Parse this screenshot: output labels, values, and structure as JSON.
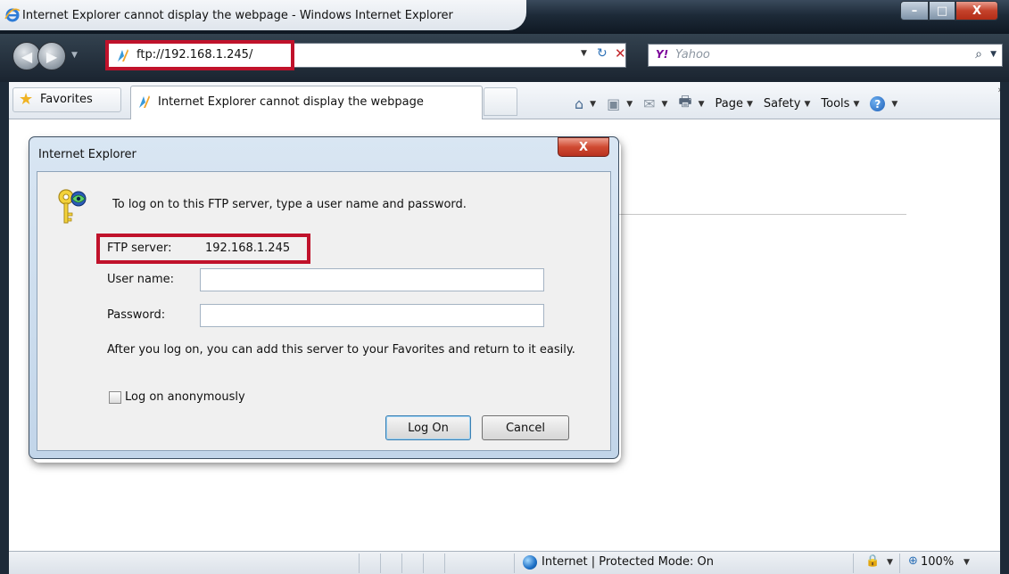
{
  "window": {
    "title": "Internet Explorer cannot display the webpage - Windows Internet Explorer",
    "minimize": "–",
    "maximize": "□",
    "close": "X"
  },
  "navigation": {
    "back": "◀",
    "forward": "▶",
    "history_dropdown": "▼",
    "address": "ftp://192.168.1.245/",
    "address_dropdown": "▼",
    "refresh": "↻",
    "stop": "✕",
    "search_provider": "Y!",
    "search_placeholder": "Yahoo",
    "search": "⌕",
    "search_dropdown": "▼"
  },
  "toolbar": {
    "favorites_label": "Favorites",
    "tab_label": "Internet Explorer cannot display the webpage",
    "home_arrow": "▼",
    "feeds_arrow": "▼",
    "mail_arrow": "▼",
    "print_arrow": "▼",
    "page_label": "Page",
    "safety_label": "Safety",
    "tools_label": "Tools",
    "overflow": "»"
  },
  "dialog": {
    "title": "Internet Explorer",
    "close": "X",
    "prompt": "To log on to this FTP server, type a user name and password.",
    "server_label": "FTP server:",
    "server_value": "192.168.1.245",
    "username_label": "User name:",
    "username_value": "",
    "password_label": "Password:",
    "password_value": "",
    "note": "After you log on, you can add this server to your Favorites and return to it easily.",
    "anonymous_label": "Log on anonymously",
    "anonymous_checked": false,
    "logon_button": "Log On",
    "cancel_button": "Cancel"
  },
  "statusbar": {
    "zone": "Internet | Protected Mode: On",
    "zoom": "100%",
    "lock_arrow": "▼",
    "zoom_arrow": "▼"
  },
  "colors": {
    "highlight_box": "#c0122b",
    "dialog_bg": "#f0f0f0",
    "window_frame": "#1d2a38"
  },
  "icons": {
    "browser": "ie-logo-icon",
    "ftp": "ftp-folder-icon",
    "favorites": "star-icon",
    "home": "home-icon",
    "feeds": "rss-icon",
    "mail": "mail-icon",
    "print": "printer-icon",
    "help": "help-icon",
    "key": "key-icon",
    "globe": "globe-icon",
    "zoom": "zoom-icon"
  }
}
